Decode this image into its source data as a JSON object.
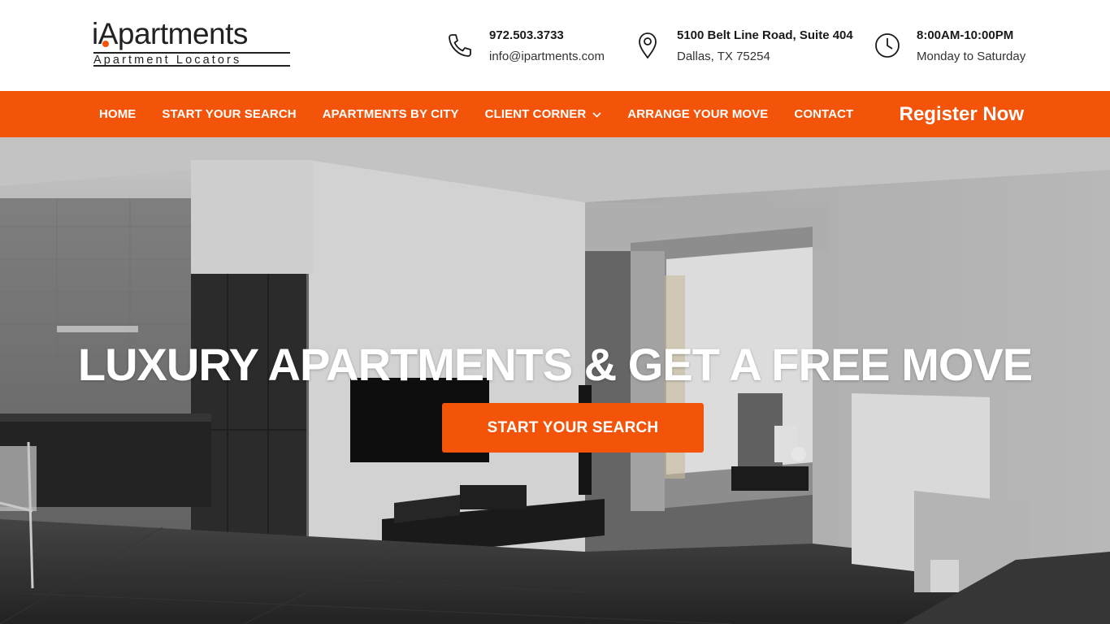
{
  "brand": {
    "name": "iApartments",
    "tagline": "Apartment Locators",
    "accent_color": "#f4540a"
  },
  "contact": {
    "phone": "972.503.3733",
    "email": "info@ipartments.com",
    "address_line1": "5100 Belt Line Road, Suite 404",
    "address_line2": "Dallas, TX 75254",
    "hours_line1": "8:00AM-10:00PM",
    "hours_line2": "Monday to Saturday",
    "icons": [
      "phone-icon",
      "map-pin-icon",
      "clock-icon"
    ]
  },
  "nav": {
    "items": [
      {
        "label": "HOME"
      },
      {
        "label": "START YOUR SEARCH"
      },
      {
        "label": "APARTMENTS BY CITY"
      },
      {
        "label": "CLIENT CORNER",
        "has_dropdown": true
      },
      {
        "label": "ARRANGE YOUR MOVE"
      },
      {
        "label": "CONTACT"
      }
    ],
    "cta": "Register Now"
  },
  "hero": {
    "title": "LUXURY APARTMENTS & GET A FREE MOVE",
    "button": "START YOUR SEARCH",
    "background": "grayscale apartment interior photo"
  }
}
